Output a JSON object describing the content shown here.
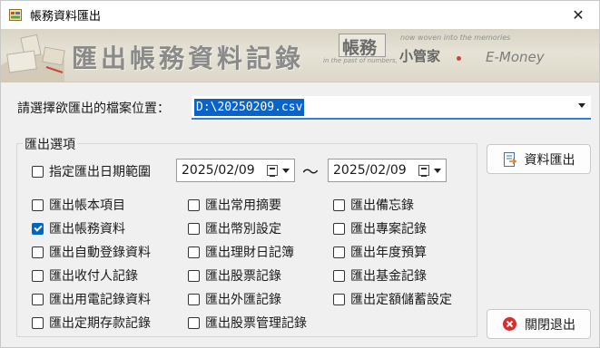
{
  "window": {
    "title": "帳務資料匯出",
    "close_glyph": "✕"
  },
  "banner": {
    "heading": "匯出帳務資料記錄",
    "logo_main": "帳務",
    "logo_sub": "小管家",
    "tagline_top": "now woven into the memories",
    "tagline_bottom": "in the past of numbers,",
    "brand": "E-Money"
  },
  "path": {
    "label": "請選擇欲匯出的檔案位置：",
    "value": "D:\\20250209.csv"
  },
  "group": {
    "legend": "匯出選項",
    "date_range": {
      "label": "指定匯出日期範圍",
      "checked": false,
      "from": "2025/02/09",
      "separator": "～",
      "to": "2025/02/09"
    },
    "options": [
      {
        "label": "匯出帳本項目",
        "checked": false
      },
      {
        "label": "匯出常用摘要",
        "checked": false
      },
      {
        "label": "匯出備忘錄",
        "checked": false
      },
      {
        "label": "匯出帳務資料",
        "checked": true
      },
      {
        "label": "匯出幣別設定",
        "checked": false
      },
      {
        "label": "匯出專案記錄",
        "checked": false
      },
      {
        "label": "匯出自動登錄資料",
        "checked": false
      },
      {
        "label": "匯出理財日記簿",
        "checked": false
      },
      {
        "label": "匯出年度預算",
        "checked": false
      },
      {
        "label": "匯出收付人記錄",
        "checked": false
      },
      {
        "label": "匯出股票記錄",
        "checked": false
      },
      {
        "label": "匯出基金記錄",
        "checked": false
      },
      {
        "label": "匯出用電記錄資料",
        "checked": false
      },
      {
        "label": "匯出外匯記錄",
        "checked": false
      },
      {
        "label": "匯出定額儲蓄設定",
        "checked": false
      },
      {
        "label": "匯出定期存款記錄",
        "checked": false
      },
      {
        "label": "匯出股票管理記錄",
        "checked": false
      }
    ]
  },
  "buttons": {
    "export_label": "資料匯出",
    "close_label": "關閉退出"
  },
  "icons": {
    "app": "app-icon",
    "export": "export-document-icon",
    "close": "close-circle-icon",
    "calendar": "calendar-icon"
  },
  "colors": {
    "accent": "#0067c0",
    "selection": "#0a63c9",
    "close_icon": "#d32f2f"
  }
}
